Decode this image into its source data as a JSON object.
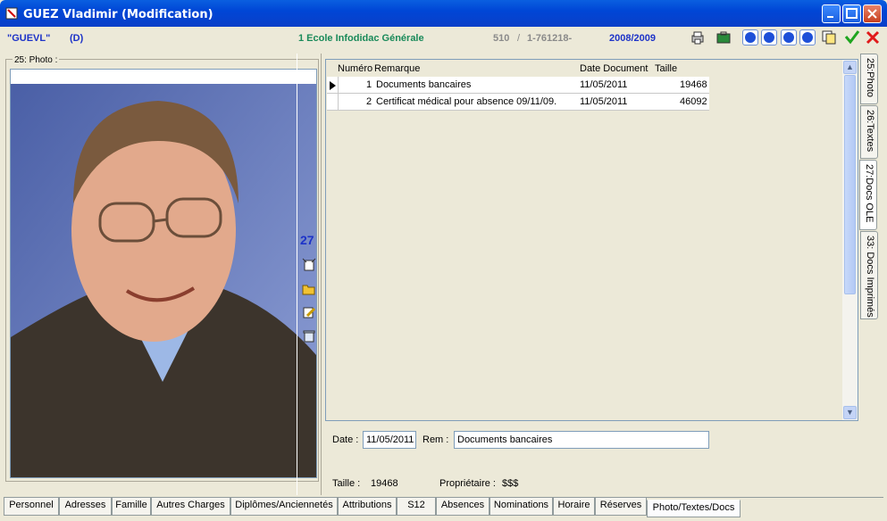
{
  "window": {
    "title": "GUEZ Vladimir (Modification)"
  },
  "info": {
    "code": "\"GUEVL\"",
    "status": "(D)",
    "school": "1 Ecole Infodidac Générale",
    "number": "510",
    "separator": "/",
    "id": "1-761218-",
    "year": "2008/2009"
  },
  "photo_panel": {
    "legend": "25: Photo :"
  },
  "tools": {
    "count": "27"
  },
  "grid": {
    "columns": [
      "Numéro",
      "Remarque",
      "Date Document",
      "Taille"
    ],
    "rows": [
      {
        "num": "1",
        "remark": "Documents bancaires",
        "date": "11/05/2011",
        "size": "19468"
      },
      {
        "num": "2",
        "remark": "Certificat médical pour absence 09/11/09.",
        "date": "11/05/2011",
        "size": "46092"
      }
    ]
  },
  "detail": {
    "date_label": "Date :",
    "date_value": "11/05/2011",
    "rem_label": "Rem :",
    "rem_value": "Documents bancaires",
    "size_label": "Taille :",
    "size_value": "19468",
    "owner_label": "Propriétaire :",
    "owner_value": "$$$"
  },
  "side_tabs": [
    "25:Photo",
    "26:Textes",
    "27:Docs OLE",
    "33: Docs Imprimés"
  ],
  "bottom_tabs": [
    "Personnel",
    "Adresses",
    "Famille",
    "Autres Charges",
    "Diplômes/Anciennetés",
    "Attributions",
    "S12",
    "Absences",
    "Nominations",
    "Horaire",
    "Réserves",
    "Photo/Textes/Docs"
  ],
  "colors": {
    "title_blue": "#0046d6",
    "school_green": "#1a8a5a",
    "info_blue": "#1d33c8"
  }
}
